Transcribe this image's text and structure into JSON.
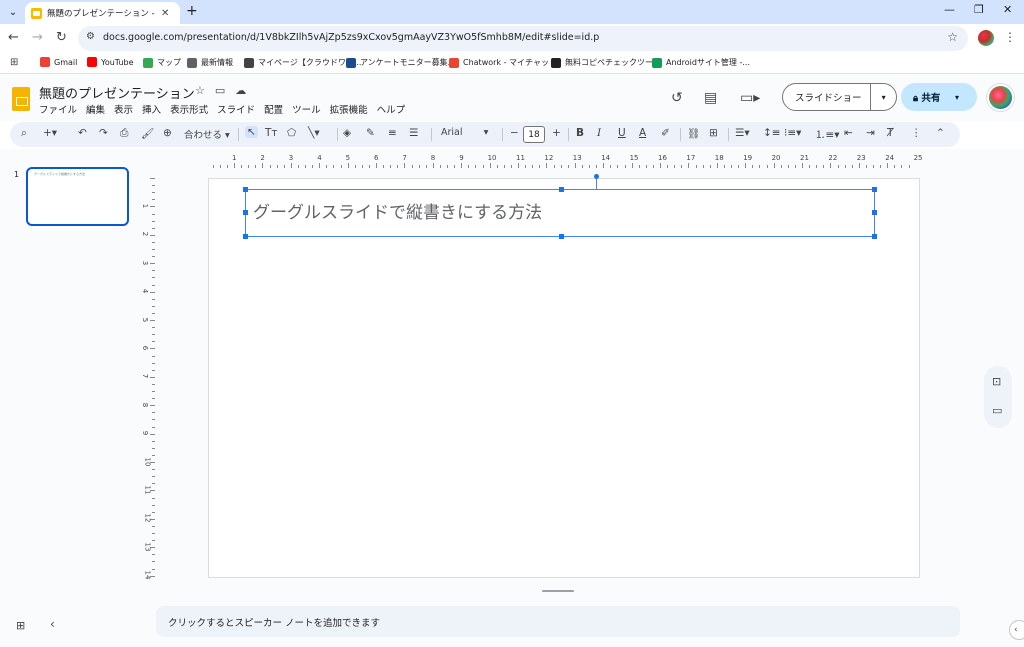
{
  "browser": {
    "tab_list_icon": "chevron-down-icon",
    "tab_title": "無題のプレゼンテーション - Google",
    "tab_close": "✕",
    "new_tab": "+",
    "window_controls": [
      "—",
      "❐",
      "✕"
    ]
  },
  "address_bar": {
    "url": "docs.google.com/presentation/d/1V8bkZIlh5vAjZp5zs9xCxov5gmAayVZ3YwO5fSmhb8M/edit#slide=id.p"
  },
  "bookmarks": [
    {
      "label": "Gmail",
      "icon": "gmail-icon",
      "color": "#ea4335"
    },
    {
      "label": "YouTube",
      "icon": "youtube-icon",
      "color": "#ff0000"
    },
    {
      "label": "マップ",
      "icon": "maps-icon",
      "color": "#34a853"
    },
    {
      "label": "最新情報",
      "icon": "chrome-icon",
      "color": "#5f6368"
    },
    {
      "label": "マイページ【クラウドワー...",
      "icon": "crowdworks-icon",
      "color": "#444444"
    },
    {
      "label": "アンケートモニター募集...",
      "icon": "survey-icon",
      "color": "#1a4d8f"
    },
    {
      "label": "Chatwork - マイチャット",
      "icon": "chatwork-icon",
      "color": "#e8472c"
    },
    {
      "label": "無料コピペチェックツー...",
      "icon": "copycheck-icon",
      "color": "#222222"
    },
    {
      "label": "Androidサイト管理 -...",
      "icon": "sheets-icon",
      "color": "#0f9d58"
    }
  ],
  "app": {
    "title": "無題のプレゼンテーション",
    "menu": [
      "ファイル",
      "編集",
      "表示",
      "挿入",
      "表示形式",
      "スライド",
      "配置",
      "ツール",
      "拡張機能",
      "ヘルプ"
    ],
    "slideshow_label": "スライドショー",
    "share_label": "共有",
    "accent_color": "#0b57d0",
    "share_bg": "#c2e7ff"
  },
  "format_toolbar": {
    "zoom_label": "合わせる",
    "font_name": "Arial",
    "font_size": "18"
  },
  "ruler": {
    "h_numbers": [
      "1",
      "2",
      "3",
      "4",
      "5",
      "6",
      "7",
      "8",
      "9",
      "10",
      "11",
      "12",
      "13",
      "14",
      "15",
      "16",
      "17",
      "18",
      "19",
      "20",
      "21",
      "22",
      "23",
      "24",
      "25"
    ],
    "v_numbers": [
      "1",
      "2",
      "3",
      "4",
      "5",
      "6",
      "7",
      "8",
      "9",
      "10",
      "11",
      "12",
      "13",
      "14"
    ]
  },
  "filmstrip": {
    "slide_number": "1",
    "thumb_text": "グーグルスライドで縦書きにする方法"
  },
  "slide": {
    "textbox_text": "グーグルスライドで縦書きにする方法"
  },
  "notes": {
    "placeholder": "クリックするとスピーカー ノートを追加できます"
  }
}
